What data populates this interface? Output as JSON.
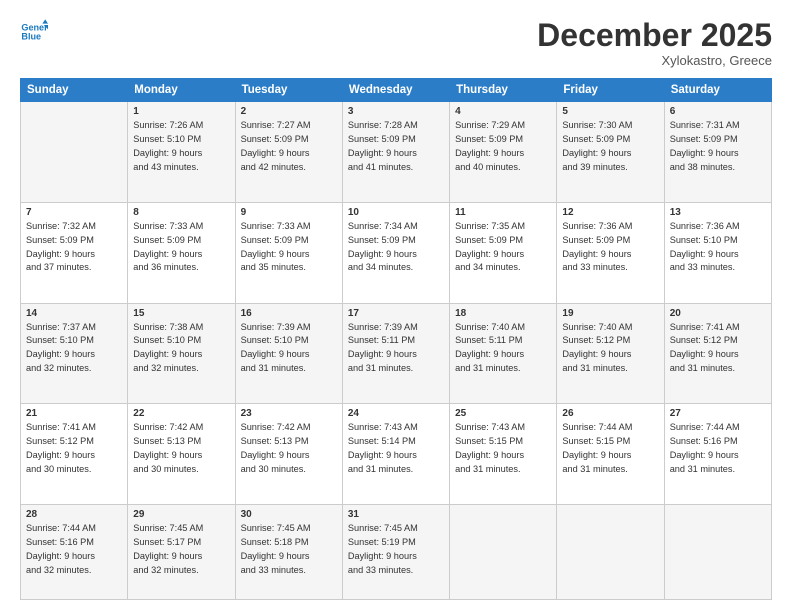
{
  "logo": {
    "line1": "General",
    "line2": "Blue"
  },
  "header": {
    "month": "December 2025",
    "location": "Xylokastro, Greece"
  },
  "days_of_week": [
    "Sunday",
    "Monday",
    "Tuesday",
    "Wednesday",
    "Thursday",
    "Friday",
    "Saturday"
  ],
  "weeks": [
    [
      {
        "day": "",
        "sunrise": "",
        "sunset": "",
        "daylight": ""
      },
      {
        "day": "1",
        "sunrise": "Sunrise: 7:26 AM",
        "sunset": "Sunset: 5:10 PM",
        "daylight": "Daylight: 9 hours and 43 minutes."
      },
      {
        "day": "2",
        "sunrise": "Sunrise: 7:27 AM",
        "sunset": "Sunset: 5:09 PM",
        "daylight": "Daylight: 9 hours and 42 minutes."
      },
      {
        "day": "3",
        "sunrise": "Sunrise: 7:28 AM",
        "sunset": "Sunset: 5:09 PM",
        "daylight": "Daylight: 9 hours and 41 minutes."
      },
      {
        "day": "4",
        "sunrise": "Sunrise: 7:29 AM",
        "sunset": "Sunset: 5:09 PM",
        "daylight": "Daylight: 9 hours and 40 minutes."
      },
      {
        "day": "5",
        "sunrise": "Sunrise: 7:30 AM",
        "sunset": "Sunset: 5:09 PM",
        "daylight": "Daylight: 9 hours and 39 minutes."
      },
      {
        "day": "6",
        "sunrise": "Sunrise: 7:31 AM",
        "sunset": "Sunset: 5:09 PM",
        "daylight": "Daylight: 9 hours and 38 minutes."
      }
    ],
    [
      {
        "day": "7",
        "sunrise": "Sunrise: 7:32 AM",
        "sunset": "Sunset: 5:09 PM",
        "daylight": "Daylight: 9 hours and 37 minutes."
      },
      {
        "day": "8",
        "sunrise": "Sunrise: 7:33 AM",
        "sunset": "Sunset: 5:09 PM",
        "daylight": "Daylight: 9 hours and 36 minutes."
      },
      {
        "day": "9",
        "sunrise": "Sunrise: 7:33 AM",
        "sunset": "Sunset: 5:09 PM",
        "daylight": "Daylight: 9 hours and 35 minutes."
      },
      {
        "day": "10",
        "sunrise": "Sunrise: 7:34 AM",
        "sunset": "Sunset: 5:09 PM",
        "daylight": "Daylight: 9 hours and 34 minutes."
      },
      {
        "day": "11",
        "sunrise": "Sunrise: 7:35 AM",
        "sunset": "Sunset: 5:09 PM",
        "daylight": "Daylight: 9 hours and 34 minutes."
      },
      {
        "day": "12",
        "sunrise": "Sunrise: 7:36 AM",
        "sunset": "Sunset: 5:09 PM",
        "daylight": "Daylight: 9 hours and 33 minutes."
      },
      {
        "day": "13",
        "sunrise": "Sunrise: 7:36 AM",
        "sunset": "Sunset: 5:10 PM",
        "daylight": "Daylight: 9 hours and 33 minutes."
      }
    ],
    [
      {
        "day": "14",
        "sunrise": "Sunrise: 7:37 AM",
        "sunset": "Sunset: 5:10 PM",
        "daylight": "Daylight: 9 hours and 32 minutes."
      },
      {
        "day": "15",
        "sunrise": "Sunrise: 7:38 AM",
        "sunset": "Sunset: 5:10 PM",
        "daylight": "Daylight: 9 hours and 32 minutes."
      },
      {
        "day": "16",
        "sunrise": "Sunrise: 7:39 AM",
        "sunset": "Sunset: 5:10 PM",
        "daylight": "Daylight: 9 hours and 31 minutes."
      },
      {
        "day": "17",
        "sunrise": "Sunrise: 7:39 AM",
        "sunset": "Sunset: 5:11 PM",
        "daylight": "Daylight: 9 hours and 31 minutes."
      },
      {
        "day": "18",
        "sunrise": "Sunrise: 7:40 AM",
        "sunset": "Sunset: 5:11 PM",
        "daylight": "Daylight: 9 hours and 31 minutes."
      },
      {
        "day": "19",
        "sunrise": "Sunrise: 7:40 AM",
        "sunset": "Sunset: 5:12 PM",
        "daylight": "Daylight: 9 hours and 31 minutes."
      },
      {
        "day": "20",
        "sunrise": "Sunrise: 7:41 AM",
        "sunset": "Sunset: 5:12 PM",
        "daylight": "Daylight: 9 hours and 31 minutes."
      }
    ],
    [
      {
        "day": "21",
        "sunrise": "Sunrise: 7:41 AM",
        "sunset": "Sunset: 5:12 PM",
        "daylight": "Daylight: 9 hours and 30 minutes."
      },
      {
        "day": "22",
        "sunrise": "Sunrise: 7:42 AM",
        "sunset": "Sunset: 5:13 PM",
        "daylight": "Daylight: 9 hours and 30 minutes."
      },
      {
        "day": "23",
        "sunrise": "Sunrise: 7:42 AM",
        "sunset": "Sunset: 5:13 PM",
        "daylight": "Daylight: 9 hours and 30 minutes."
      },
      {
        "day": "24",
        "sunrise": "Sunrise: 7:43 AM",
        "sunset": "Sunset: 5:14 PM",
        "daylight": "Daylight: 9 hours and 31 minutes."
      },
      {
        "day": "25",
        "sunrise": "Sunrise: 7:43 AM",
        "sunset": "Sunset: 5:15 PM",
        "daylight": "Daylight: 9 hours and 31 minutes."
      },
      {
        "day": "26",
        "sunrise": "Sunrise: 7:44 AM",
        "sunset": "Sunset: 5:15 PM",
        "daylight": "Daylight: 9 hours and 31 minutes."
      },
      {
        "day": "27",
        "sunrise": "Sunrise: 7:44 AM",
        "sunset": "Sunset: 5:16 PM",
        "daylight": "Daylight: 9 hours and 31 minutes."
      }
    ],
    [
      {
        "day": "28",
        "sunrise": "Sunrise: 7:44 AM",
        "sunset": "Sunset: 5:16 PM",
        "daylight": "Daylight: 9 hours and 32 minutes."
      },
      {
        "day": "29",
        "sunrise": "Sunrise: 7:45 AM",
        "sunset": "Sunset: 5:17 PM",
        "daylight": "Daylight: 9 hours and 32 minutes."
      },
      {
        "day": "30",
        "sunrise": "Sunrise: 7:45 AM",
        "sunset": "Sunset: 5:18 PM",
        "daylight": "Daylight: 9 hours and 33 minutes."
      },
      {
        "day": "31",
        "sunrise": "Sunrise: 7:45 AM",
        "sunset": "Sunset: 5:19 PM",
        "daylight": "Daylight: 9 hours and 33 minutes."
      },
      {
        "day": "",
        "sunrise": "",
        "sunset": "",
        "daylight": ""
      },
      {
        "day": "",
        "sunrise": "",
        "sunset": "",
        "daylight": ""
      },
      {
        "day": "",
        "sunrise": "",
        "sunset": "",
        "daylight": ""
      }
    ]
  ]
}
